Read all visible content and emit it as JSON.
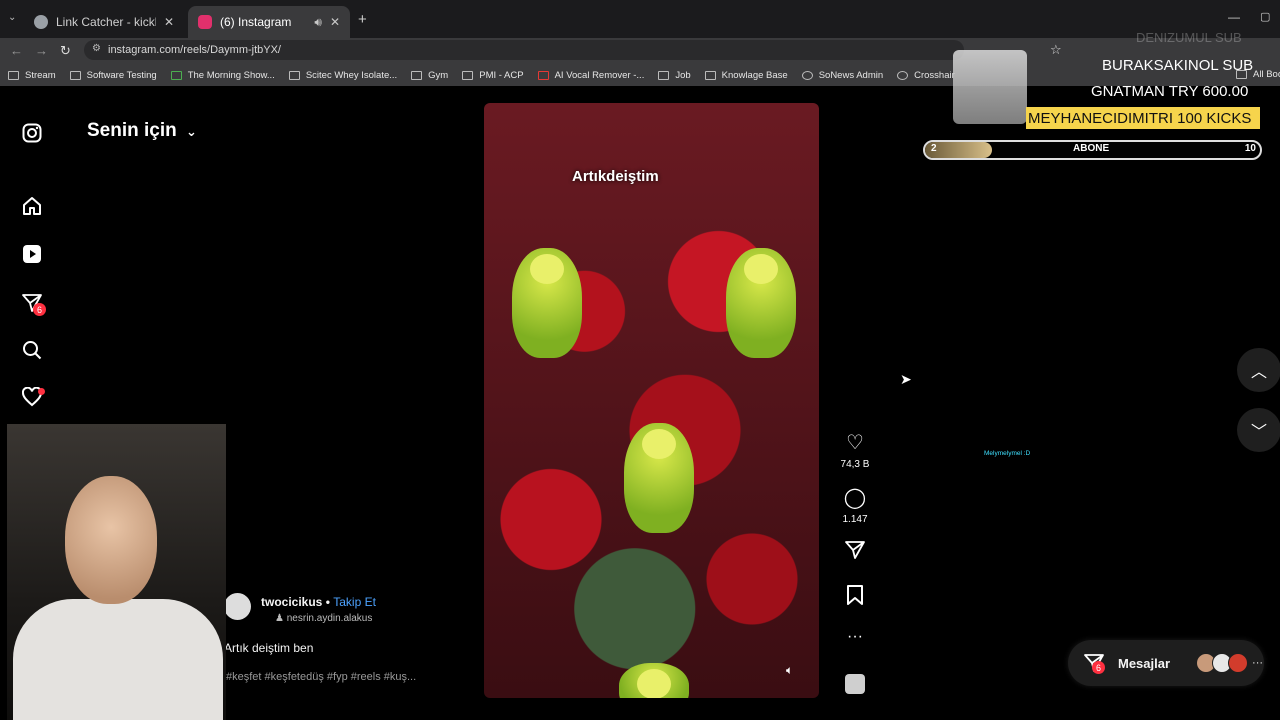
{
  "browser": {
    "tabs": [
      {
        "title": "Link Catcher - kicklogz Tools",
        "favicon_color": "#9aa0a6"
      },
      {
        "title": "(6) Instagram",
        "favicon_color": "#e1306c"
      }
    ],
    "url": "instagram.com/reels/Daymm-jtbYX/",
    "bookmarks": [
      "Stream",
      "Software Testing",
      "The Morning Show...",
      "Scitec Whey Isolate...",
      "Gym",
      "PMI - ACP",
      "AI Vocal Remover -...",
      "Job",
      "Knowlage Base",
      "SoNews Admin",
      "Crosshair",
      "All Book"
    ]
  },
  "instagram": {
    "feed_title": "Senin için",
    "sidebar_badges": {
      "reels_count": "6"
    },
    "video_caption": "Artıkdeiştim",
    "actions": {
      "likes": "74,3 B",
      "comments": "1.147"
    },
    "post": {
      "username": "twocicikus",
      "separator": "•",
      "follow_label": "Takip Et",
      "audio": "nesrin.aydin.alakus",
      "caption": "Artık deiştim ben",
      "hashtags": "#keşfet #keşfetedüş #fyp #reels #kuş..."
    },
    "messages": {
      "label": "Mesajlar",
      "badge": "6"
    }
  },
  "overlay": {
    "sub_line_faded": "DENIZUMUL SUB",
    "sub_line": "BURAKSAKINOL  SUB",
    "try_line": "GNATMAN  TRY 600.00",
    "kicks_line": "MEYHANECIDIMITRI  100 KICKS",
    "goal": {
      "label": "ABONE",
      "min": "2",
      "max": "10",
      "progress_fraction": 0.2
    },
    "chat": "Melymelymel :D"
  },
  "colors": {
    "accent_blue": "#4da3ff",
    "badge_red": "#ff3040",
    "kicks_yellow": "#f6d44c"
  }
}
